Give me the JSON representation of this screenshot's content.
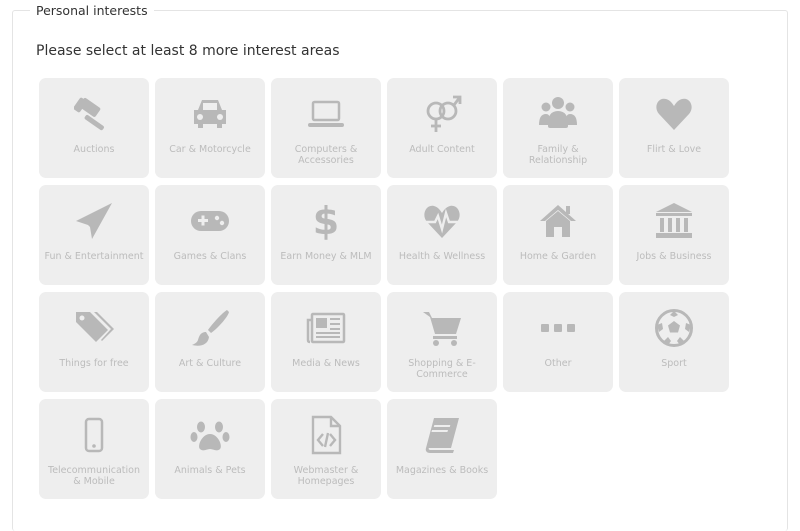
{
  "legend": "Personal interests",
  "prompt": "Please select at least 8 more interest areas",
  "icon_color": "#b8b8b8",
  "tile_color": "#eeeeee",
  "tiles": [
    {
      "id": "auctions",
      "icon": "gavel-icon",
      "label": "Auctions"
    },
    {
      "id": "car",
      "icon": "car-icon",
      "label": "Car & Motorcycle"
    },
    {
      "id": "computers",
      "icon": "laptop-icon",
      "label": "Computers & Accessories"
    },
    {
      "id": "adult",
      "icon": "gender-icon",
      "label": "Adult Content"
    },
    {
      "id": "family",
      "icon": "users-icon",
      "label": "Family & Relationship"
    },
    {
      "id": "flirt",
      "icon": "heart-icon",
      "label": "Flirt & Love"
    },
    {
      "id": "fun",
      "icon": "paper-plane-icon",
      "label": "Fun & Entertainment"
    },
    {
      "id": "games",
      "icon": "gamepad-icon",
      "label": "Games & Clans"
    },
    {
      "id": "money",
      "icon": "dollar-icon",
      "label": "Earn Money & MLM"
    },
    {
      "id": "health",
      "icon": "heartbeat-icon",
      "label": "Health & Wellness"
    },
    {
      "id": "home",
      "icon": "home-icon",
      "label": "Home & Garden"
    },
    {
      "id": "jobs",
      "icon": "bank-icon",
      "label": "Jobs & Business"
    },
    {
      "id": "free",
      "icon": "tags-icon",
      "label": "Things for free"
    },
    {
      "id": "art",
      "icon": "paintbrush-icon",
      "label": "Art & Culture"
    },
    {
      "id": "media",
      "icon": "newspaper-icon",
      "label": "Media & News"
    },
    {
      "id": "shopping",
      "icon": "shopping-cart-icon",
      "label": "Shopping & E-Commerce"
    },
    {
      "id": "other",
      "icon": "ellipsis-icon",
      "label": "Other"
    },
    {
      "id": "sport",
      "icon": "soccer-ball-icon",
      "label": "Sport"
    },
    {
      "id": "telecom",
      "icon": "mobile-phone-icon",
      "label": "Telecommunication & Mobile"
    },
    {
      "id": "animals",
      "icon": "paw-icon",
      "label": "Animals & Pets"
    },
    {
      "id": "webmaster",
      "icon": "file-code-icon",
      "label": "Webmaster & Homepages"
    },
    {
      "id": "magazines",
      "icon": "book-icon",
      "label": "Magazines & Books"
    }
  ]
}
